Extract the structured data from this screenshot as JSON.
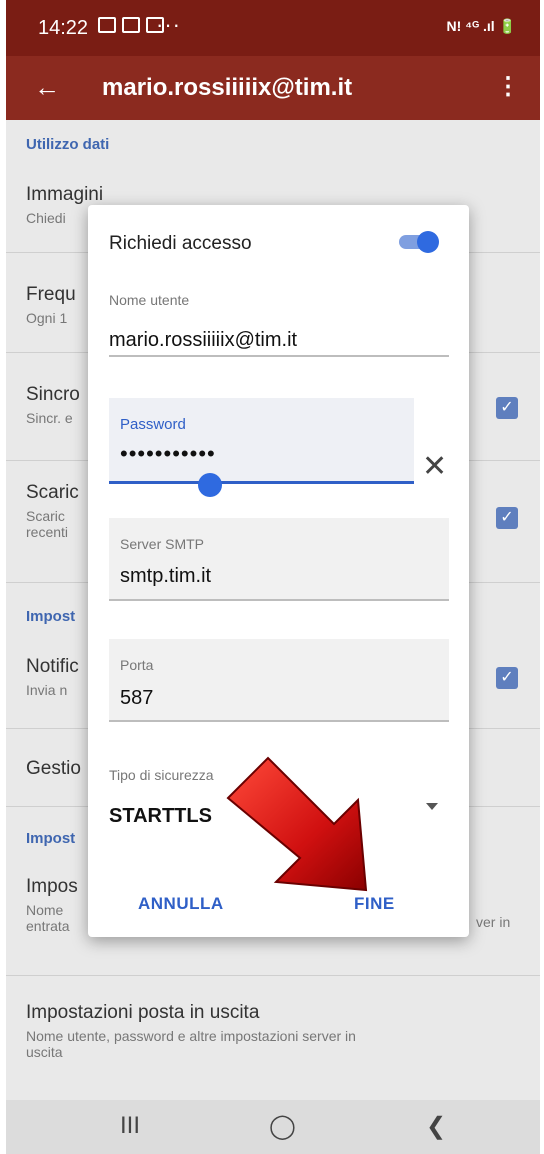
{
  "status_bar": {
    "time": "14:22",
    "dots": "···",
    "system_icons": "◂•▌"
  },
  "app_bar": {
    "back_icon": "arrow-left",
    "title": "mario.rossiiiiix@tim.it",
    "more_icon": "vertical-dots"
  },
  "background": {
    "section_1": "Utilizzo dati",
    "items": [
      {
        "title": "Immagini",
        "subtitle": "Chiedi"
      },
      {
        "title": "Frequ",
        "subtitle": "Ogni 1"
      },
      {
        "title": "Sincro",
        "subtitle": "Sincr. e"
      },
      {
        "title": "Scaric",
        "subtitle": "Scaric",
        "subtitle2": "recenti"
      },
      {
        "title": "Notific",
        "subtitle": "Invia n"
      },
      {
        "title": "Gestio"
      },
      {
        "title": "Impos",
        "subtitle": "Nome",
        "subtitle2": "entrata",
        "right_fragment": "ver in"
      },
      {
        "title": "Impostazioni posta in uscita",
        "subtitle": "Nome utente, password e altre impostazioni server in",
        "subtitle2": "uscita"
      }
    ],
    "section_2": "Impost",
    "section_3": "Impost"
  },
  "dialog": {
    "title": "Richiedi accesso",
    "toggle_on": true,
    "username_label": "Nome utente",
    "username_value": "mario.rossiiiiix@tim.it",
    "password_label": "Password",
    "password_value": "•••••••••••",
    "clear_icon": "✕",
    "smtp_label": "Server SMTP",
    "smtp_value": "smtp.tim.it",
    "port_label": "Porta",
    "port_value": "587",
    "security_label": "Tipo di sicurezza",
    "security_value": "STARTTLS",
    "cancel_label": "ANNULLA",
    "done_label": "FINE"
  },
  "nav_bar": {
    "recents": "III",
    "home": "◯",
    "back": "❮"
  },
  "colors": {
    "app_bar": "#8b2a1f",
    "status_bar": "#7a1d14",
    "accent": "#2f5fc7",
    "arrow": "#c41010"
  }
}
